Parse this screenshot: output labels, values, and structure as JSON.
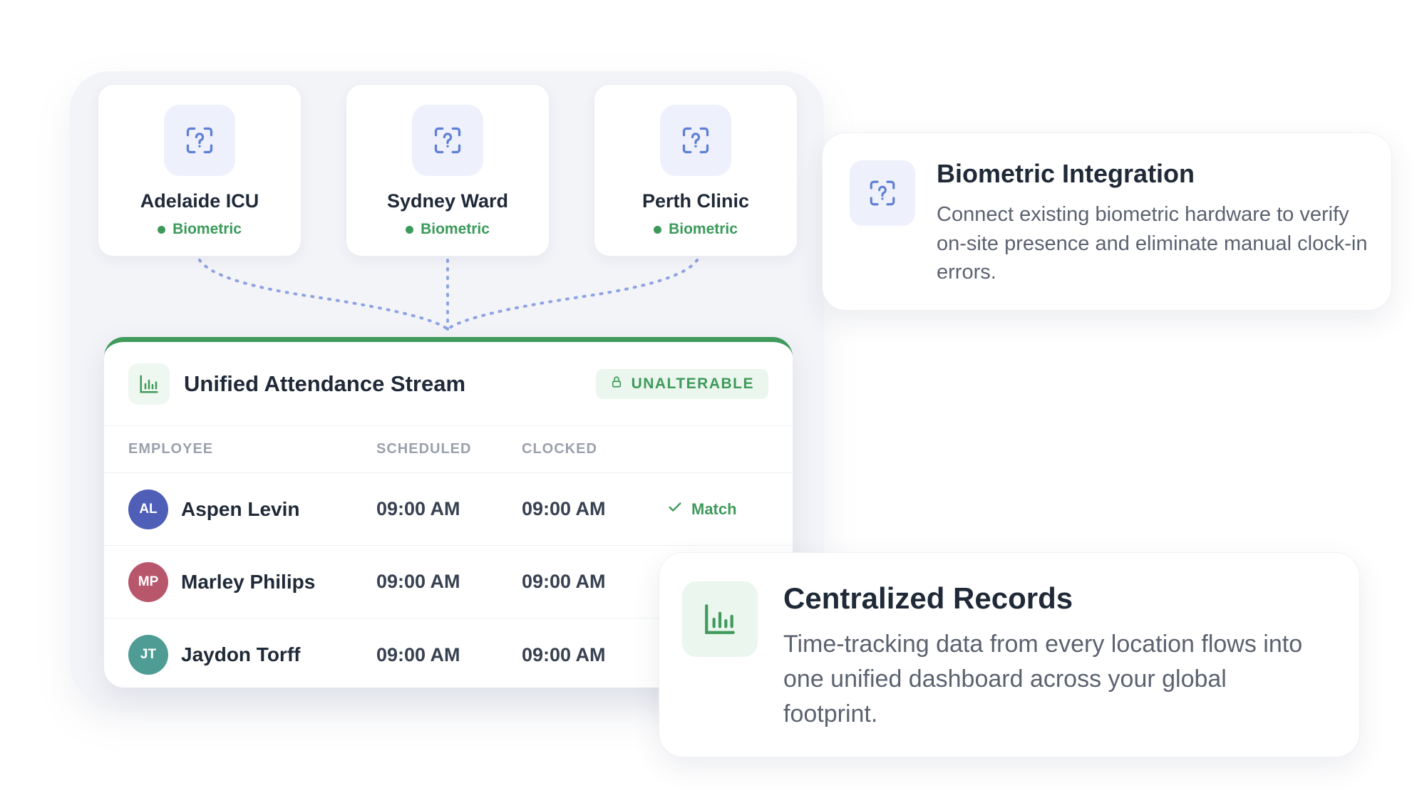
{
  "sites": [
    {
      "name": "Adelaide ICU",
      "status": "Biometric"
    },
    {
      "name": "Sydney Ward",
      "status": "Biometric"
    },
    {
      "name": "Perth Clinic",
      "status": "Biometric"
    }
  ],
  "stream": {
    "title": "Unified Attendance Stream",
    "badge": "UNALTERABLE",
    "columns": {
      "employee": "EMPLOYEE",
      "scheduled": "SCHEDULED",
      "clocked": "CLOCKED"
    },
    "rows": [
      {
        "initials": "AL",
        "name": "Aspen Levin",
        "scheduled": "09:00 AM",
        "clocked": "09:00 AM",
        "status": "Match",
        "avatar_color": "#4f5fb8"
      },
      {
        "initials": "MP",
        "name": "Marley Philips",
        "scheduled": "09:00 AM",
        "clocked": "09:00 AM",
        "status": "",
        "avatar_color": "#b8566c"
      },
      {
        "initials": "JT",
        "name": "Jaydon Torff",
        "scheduled": "09:00 AM",
        "clocked": "09:00 AM",
        "status": "",
        "avatar_color": "#4f9c95"
      }
    ]
  },
  "features": {
    "biometric": {
      "title": "Biometric Integration",
      "description": "Connect existing biometric hardware to verify on-site presence and eliminate manual clock-in errors."
    },
    "records": {
      "title": "Centralized Records",
      "description": "Time-tracking data from every location flows into one unified dashboard across your global footprint."
    }
  },
  "colors": {
    "accent_green": "#3f9a5b",
    "accent_blue": "#5f7fd6",
    "icon_bg_blue": "#eef1fb",
    "icon_bg_green": "#eaf6ee"
  },
  "icons": {
    "site": "face-scan-icon",
    "stream": "bar-chart-icon",
    "badge": "lock-icon",
    "match": "check-icon"
  }
}
